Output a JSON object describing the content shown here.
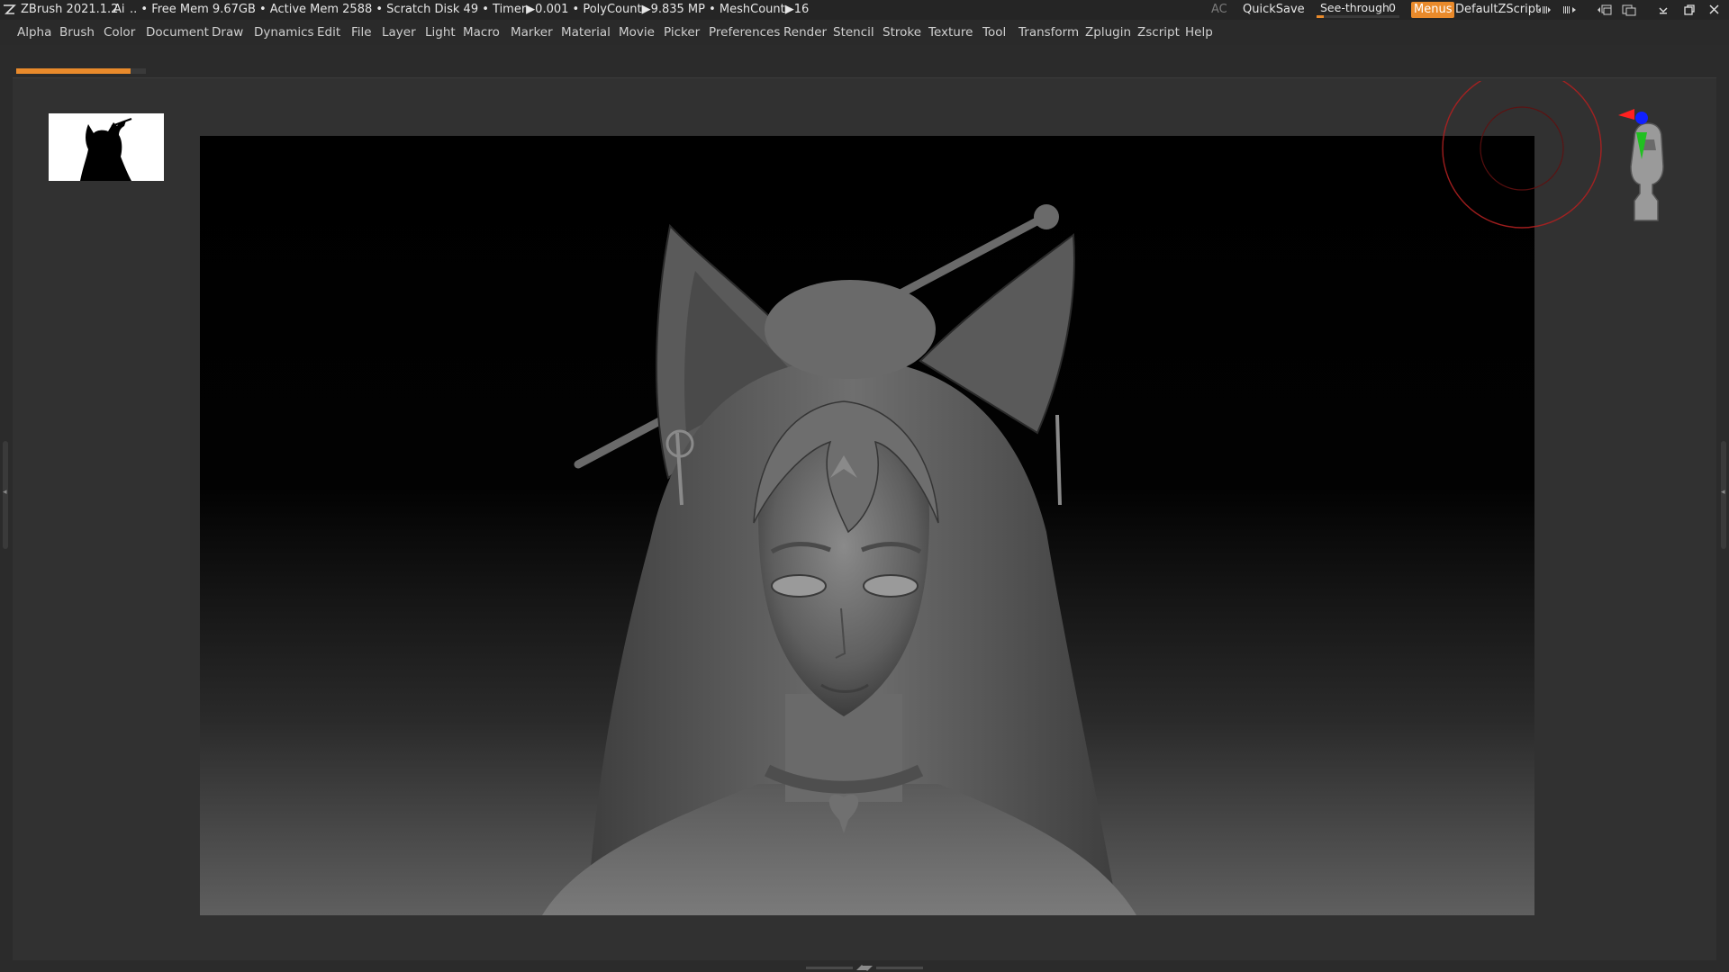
{
  "titlebar": {
    "app_title": "ZBrush 2021.1.2",
    "ai_label": "Ai",
    "stats": ".. • Free Mem 9.67GB • Active Mem 2588 • Scratch Disk 49 •  Timer▶0.001 • PolyCount▶9.835 MP  • MeshCount▶16",
    "ac_label": "AC",
    "quicksave_label": "QuickSave",
    "seethrough_label": "See-through",
    "seethrough_value": "0",
    "menus_label": "Menus",
    "script_label": "DefaultZScript",
    "icons": [
      "menu-size-icon",
      "menu-width-icon",
      "swap-layout-icon",
      "popup-icon",
      "minimize-icon",
      "restore-icon",
      "close-icon"
    ],
    "accent_color": "#e98a2b"
  },
  "menubar": {
    "items": [
      "Alpha",
      "Brush",
      "Color",
      "Document",
      "Draw",
      "Dynamics",
      "Edit",
      "File",
      "Layer",
      "Light",
      "Macro",
      "Marker",
      "Material",
      "Movie",
      "Picker",
      "Preferences",
      "Render",
      "Stencil",
      "Stroke",
      "Texture",
      "Tool",
      "Transform",
      "Zplugin",
      "Zscript",
      "Help"
    ]
  },
  "progress": {
    "fraction": 0.88
  },
  "canvas": {
    "subject": "sculpted fox-eared girl bust",
    "thumbnail_icon": "silhouette-thumbnail-icon"
  },
  "navigation": {
    "rotate_ring_icon": "rotate-ring-icon",
    "orientation_gizmo_icon": "orientation-head-icon",
    "axis_colors": {
      "x": "#ff2020",
      "y": "#20c020",
      "z": "#1020ff"
    }
  }
}
